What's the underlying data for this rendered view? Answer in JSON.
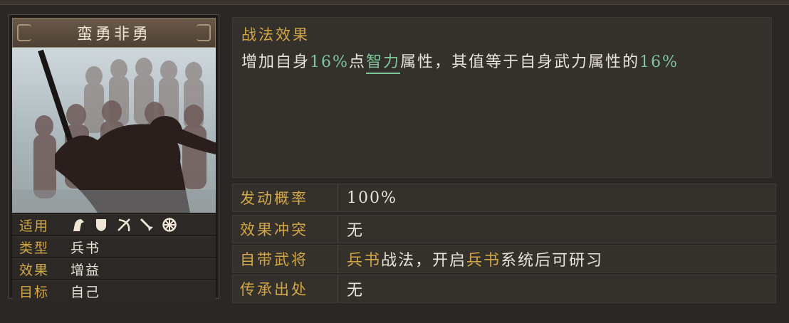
{
  "card": {
    "title": "蛮勇非勇",
    "rows": [
      {
        "label": "适用",
        "icons": [
          "cavalry-icon",
          "shield-icon",
          "archer-icon",
          "spear-icon",
          "siege-icon"
        ]
      },
      {
        "label": "类型",
        "value": "兵书"
      },
      {
        "label": "效果",
        "value": "增益"
      },
      {
        "label": "目标",
        "value": "自己"
      }
    ]
  },
  "effect": {
    "heading": "战法效果",
    "desc_1": "增加自身",
    "desc_pct_1": "16%",
    "desc_2": "点",
    "desc_attr": "智力",
    "desc_3": "属性，其值等于自身武力属性的",
    "desc_pct_2": "16%"
  },
  "props": {
    "trigger_rate": {
      "label": "发动概率",
      "value": "100%"
    },
    "conflict": {
      "label": "效果冲突",
      "value": "无"
    },
    "general": {
      "label": "自带武将",
      "v1": "兵书",
      "v2": "战法，开启",
      "v3": "兵书",
      "v4": "系统后可研习"
    },
    "inherit": {
      "label": "传承出处",
      "value": "无"
    }
  },
  "colors": {
    "gold": "#d2a847",
    "green": "#7fc79a",
    "text": "#e9e3d8",
    "panel": "#34302c",
    "background": "#2b2724"
  }
}
